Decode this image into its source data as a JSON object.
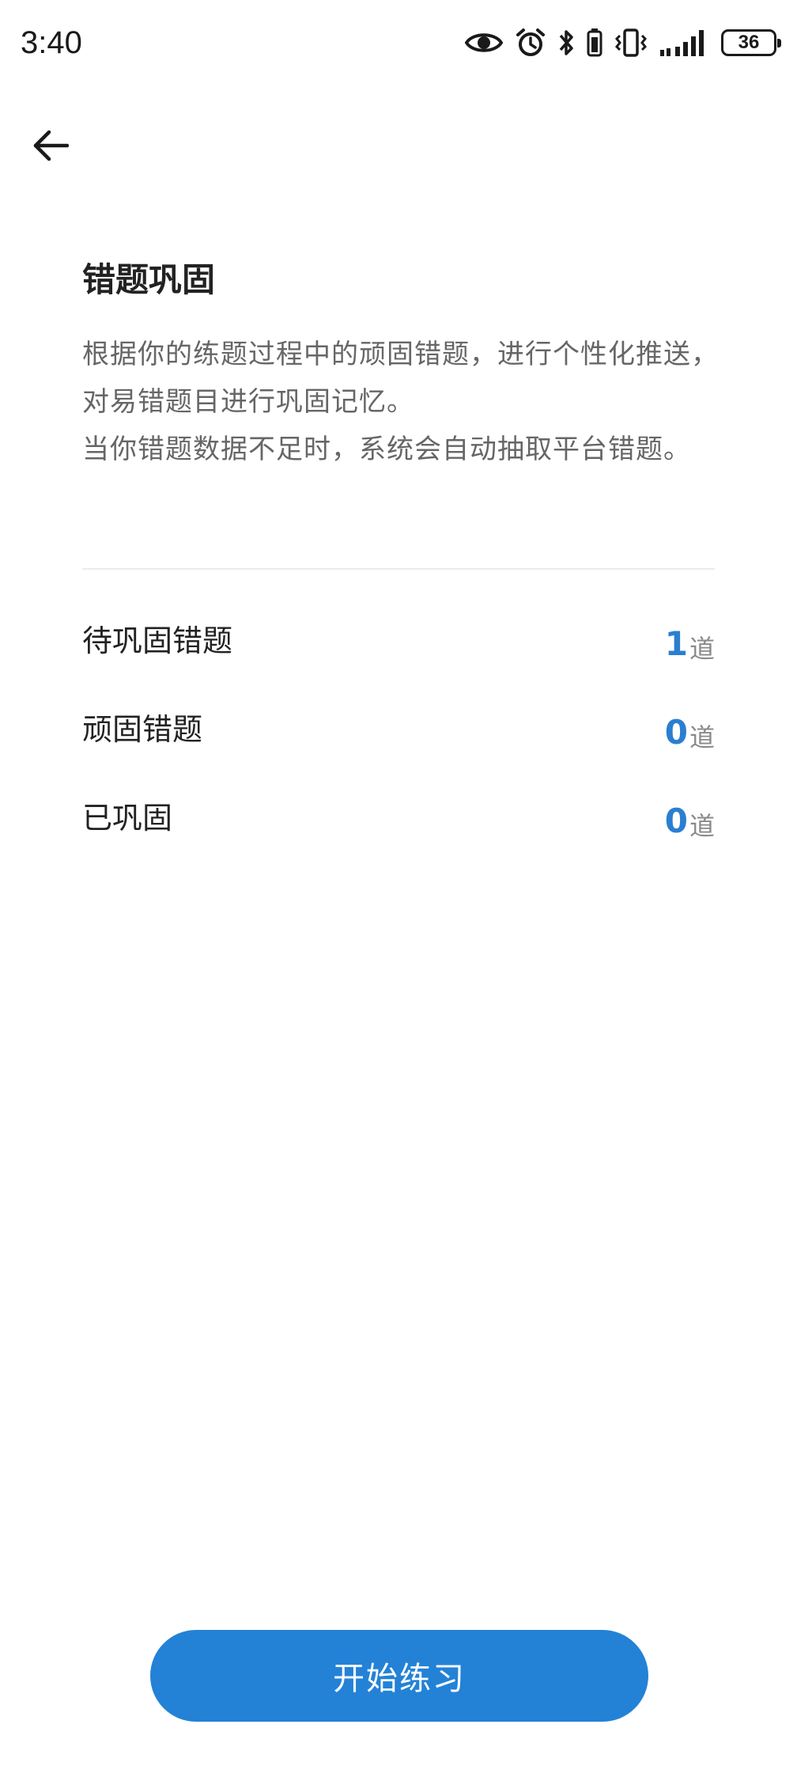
{
  "status_bar": {
    "time": "3:40",
    "battery_level": "36",
    "icons": [
      "eye-icon",
      "alarm-icon",
      "bluetooth-icon",
      "battery-saver-icon",
      "vibrate-icon",
      "signal-icon",
      "battery-icon"
    ]
  },
  "nav": {
    "back_icon": "arrow-left-icon"
  },
  "page": {
    "title": "错题巩固",
    "description_lines": [
      "根据你的练题过程中的顽固错题，进行个性化推送，对易错题目进行巩固记忆。",
      "当你错题数据不足时，系统会自动抽取平台错题。"
    ]
  },
  "stats": [
    {
      "label": "待巩固错题",
      "value": "1",
      "unit": "道"
    },
    {
      "label": "顽固错题",
      "value": "0",
      "unit": "道"
    },
    {
      "label": "已巩固",
      "value": "0",
      "unit": "道"
    }
  ],
  "colors": {
    "accent": "#2382d6",
    "stat_number": "#2b7fd0",
    "text_primary": "#222222",
    "text_secondary": "#666666"
  },
  "actions": {
    "start_label": "开始练习"
  }
}
